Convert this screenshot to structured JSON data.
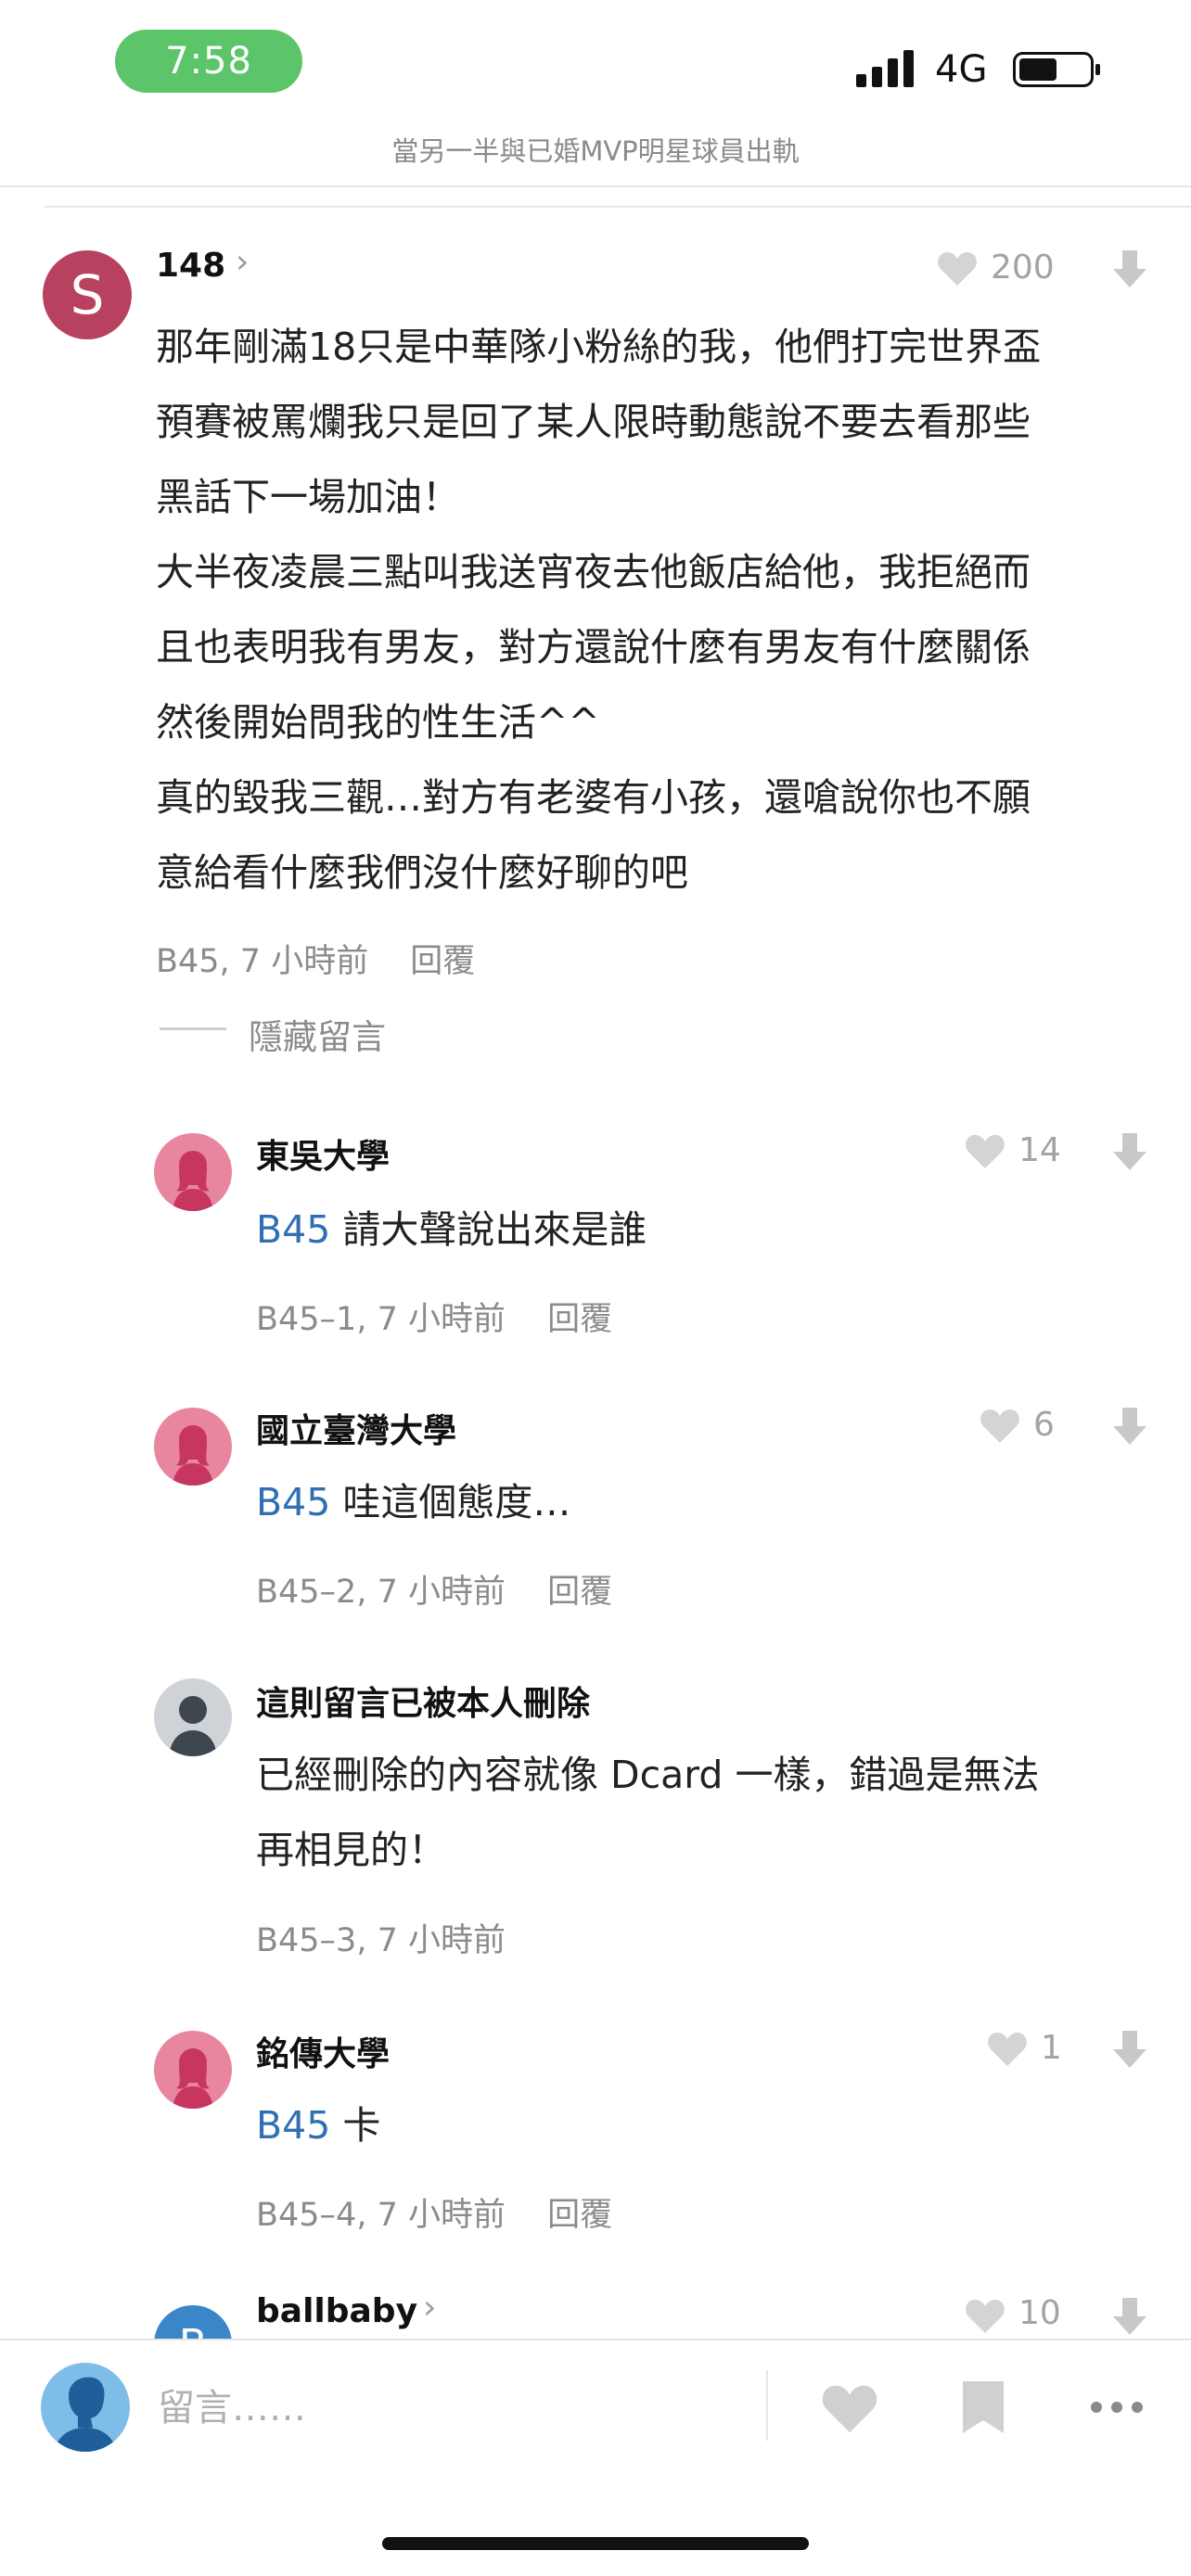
{
  "status_bar": {
    "time": "7:58",
    "network": "4G"
  },
  "top_bar": {
    "title": "當另一半與已婚MVP明星球員出軌"
  },
  "main_comment": {
    "avatar_letter": "S",
    "author": "148",
    "likes": "200",
    "lines": [
      "那年剛滿18只是中華隊小粉絲的我，他們打完世界盃",
      "預賽被罵爛我只是回了某人限時動態說不要去看那些",
      "黑話下一場加油！",
      "大半夜凌晨三點叫我送宵夜去他飯店給他，我拒絕而",
      "且也表明我有男友，對方還說什麼有男友有什麼關係",
      "然後開始問我的性生活^^",
      "真的毀我三觀…對方有老婆有小孩，還嗆說你也不願",
      "意給看什麼我們沒什麼好聊的吧"
    ],
    "meta": "B45, 7 小時前",
    "reply_label": "回覆",
    "hide_label": "隱藏留言"
  },
  "replies": [
    {
      "author": "東吳大學",
      "tag": "B45",
      "text": "請大聲說出來是誰",
      "likes": "14",
      "meta": "B45–1, 7 小時前",
      "reply_label": "回覆"
    },
    {
      "author": "國立臺灣大學",
      "tag": "B45",
      "text": "哇這個態度…",
      "likes": "6",
      "meta": "B45–2, 7 小時前",
      "reply_label": "回覆"
    },
    {
      "author": "這則留言已被本人刪除",
      "lines": [
        "已經刪除的內容就像 Dcard 一樣，錯過是無法",
        "再相見的！"
      ],
      "meta": "B45–3, 7 小時前"
    },
    {
      "author": "銘傳大學",
      "tag": "B45",
      "text": "卡",
      "likes": "1",
      "meta": "B45–4, 7 小時前",
      "reply_label": "回覆"
    },
    {
      "author": "ballbaby",
      "avatar_letter": "B",
      "likes": "10"
    }
  ],
  "bottom_bar": {
    "input_placeholder": "留言……"
  },
  "colors": {
    "accent_blue": "#2f6fb2",
    "avatar_red": "#b7415f",
    "time_green": "#5cc56a"
  },
  "icons": [
    "signal-icon",
    "battery-icon",
    "chevron-right-icon",
    "heart-icon",
    "downvote-icon",
    "bookmark-icon",
    "more-icon"
  ]
}
